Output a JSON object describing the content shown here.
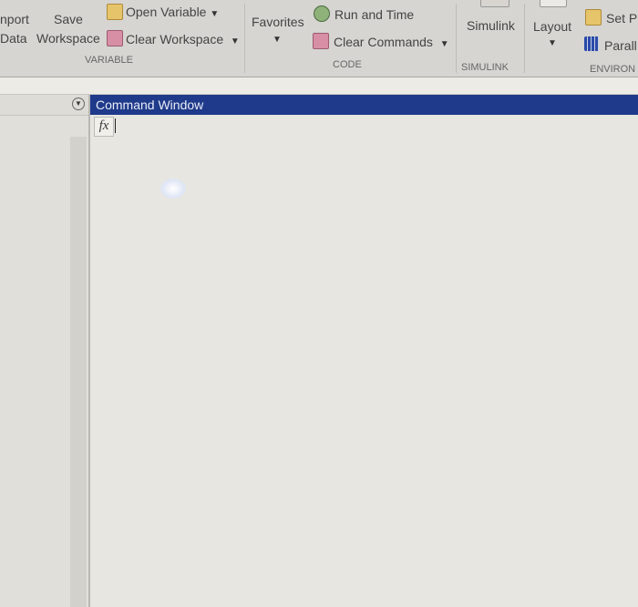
{
  "ribbon": {
    "import_data": {
      "line1": "nport",
      "line2": "Data"
    },
    "save_workspace": {
      "line1": "Save",
      "line2": "Workspace"
    },
    "open_variable": "Open Variable",
    "clear_workspace": "Clear Workspace",
    "variable_section": "VARIABLE",
    "favorites": "Favorites",
    "run_and_time": "Run and Time",
    "clear_commands": "Clear Commands",
    "code_section": "CODE",
    "simulink": "Simulink",
    "simulink_section": "SIMULINK",
    "layout": "Layout",
    "set_path": "Set P",
    "parallel": "Parall",
    "environment_section": "ENVIRON"
  },
  "command_window": {
    "title": "Command Window",
    "prompt_icon": "fx",
    "input": ""
  },
  "colors": {
    "title_bar": "#1f3a8a",
    "ribbon": "#d6d5d1"
  }
}
